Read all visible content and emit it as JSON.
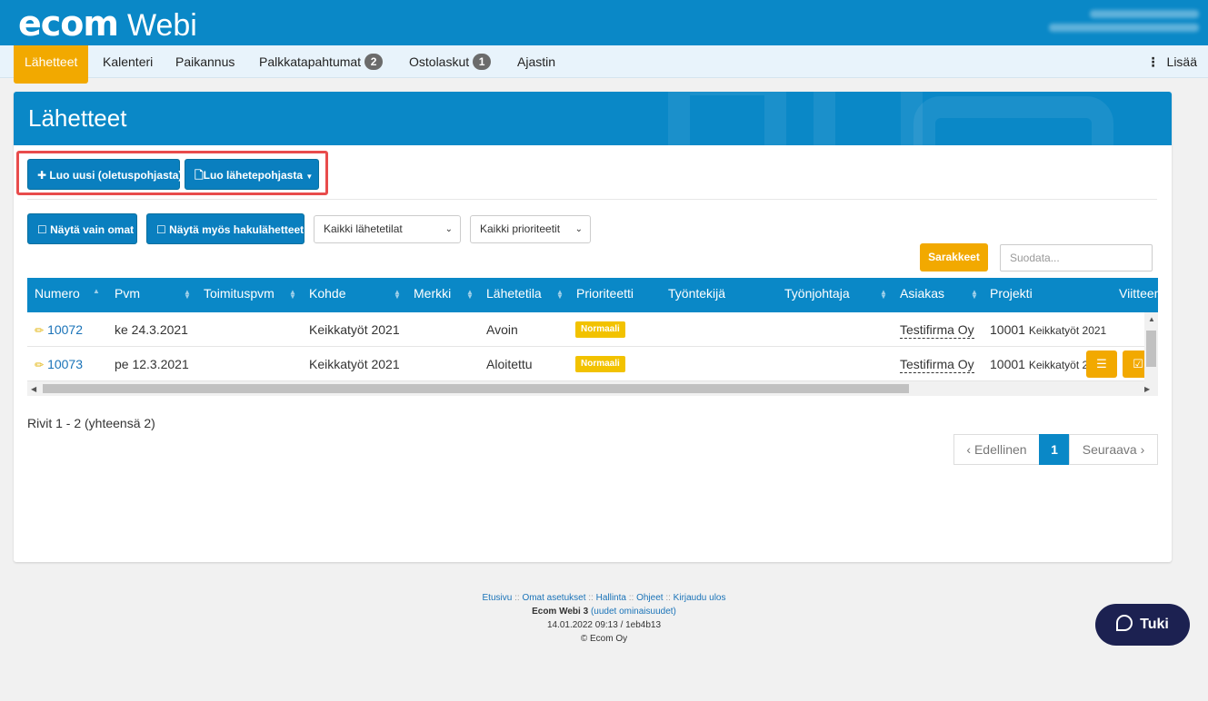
{
  "app": {
    "brand": "ecom",
    "product": "Webi"
  },
  "nav": {
    "items": [
      {
        "label": "Lähetteet"
      },
      {
        "label": "Kalenteri"
      },
      {
        "label": "Paikannus"
      },
      {
        "label": "Palkkatapahtumat",
        "badge": "2"
      },
      {
        "label": "Ostolaskut",
        "badge": "1"
      },
      {
        "label": "Ajastin"
      }
    ],
    "more": "Lisää"
  },
  "page": {
    "title": "Lähetteet"
  },
  "toolbar": {
    "new_default": "Luo uusi (oletuspohjasta)",
    "new_template": "Luo lähetepohjasta",
    "show_own": "Näytä vain omat",
    "show_search": "Näytä myös hakulähetteet",
    "status_select": "Kaikki lähetetilat",
    "priority_select": "Kaikki prioriteetit",
    "columns": "Sarakkeet",
    "filter_placeholder": "Suodata..."
  },
  "table": {
    "headers": [
      "Numero",
      "Pvm",
      "Toimituspvm",
      "Kohde",
      "Merkki",
      "Lähetetila",
      "Prioriteetti",
      "Työntekijä",
      "Työnjohtaja",
      "Asiakas",
      "Projekti",
      "Viitteen"
    ],
    "rows": [
      {
        "numero": "10072",
        "pvm": "ke 24.3.2021",
        "kohde": "Keikkatyöt 2021",
        "tila": "Avoin",
        "prioriteetti": "Normaali",
        "asiakas": "Testifirma Oy",
        "projekti_no": "10001",
        "projekti_name": "Keikkatyöt 2021"
      },
      {
        "numero": "10073",
        "pvm": "pe 12.3.2021",
        "kohde": "Keikkatyöt 2021",
        "tila": "Aloitettu",
        "prioriteetti": "Normaali",
        "asiakas": "Testifirma Oy",
        "projekti_no": "10001",
        "projekti_name": "Keikkatyöt 2"
      }
    ]
  },
  "pagination": {
    "info": "Rivit 1 - 2 (yhteensä 2)",
    "prev": "Edellinen",
    "current": "1",
    "next": "Seuraava"
  },
  "footer": {
    "links": [
      "Etusivu",
      "Omat asetukset",
      "Hallinta",
      "Ohjeet",
      "Kirjaudu ulos"
    ],
    "version": "Ecom Webi 3",
    "new_features": "(uudet ominaisuudet)",
    "build": "14.01.2022 09:13 / 1eb4b13",
    "copyright": "© Ecom Oy"
  },
  "support": {
    "label": "Tuki"
  }
}
